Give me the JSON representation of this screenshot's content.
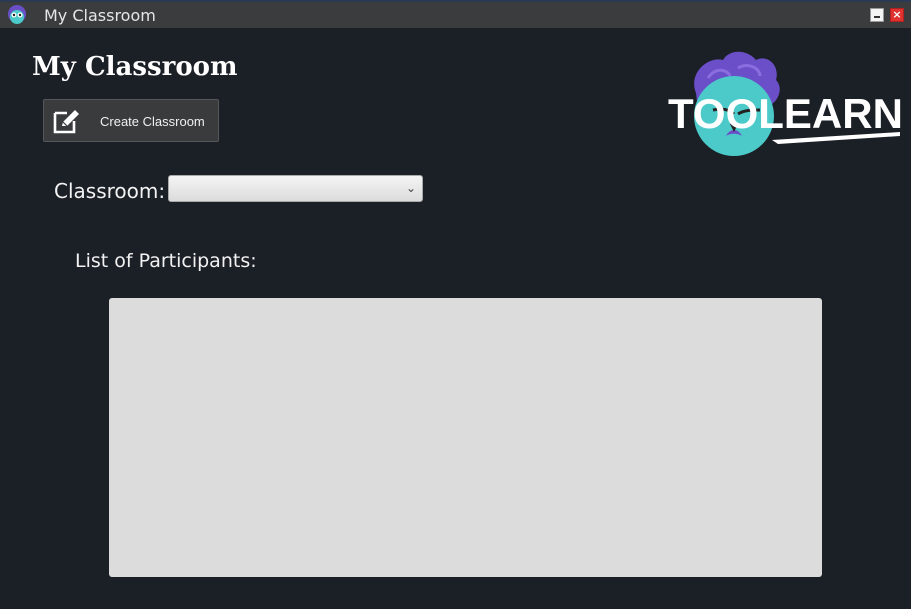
{
  "window": {
    "title": "My Classroom",
    "icons": {
      "app": "toolearn-mascot-icon",
      "minimize": "minimize-icon",
      "close": "close-icon"
    }
  },
  "page": {
    "title": "My Classroom",
    "create_button": {
      "label": "Create Classroom",
      "icon": "edit-icon"
    },
    "logo_text": "TOOLEARN",
    "classroom_label": "Classroom:",
    "classroom_select": {
      "selected": "",
      "icon": "chevron-down-icon"
    },
    "participants_label": "List of Participants:",
    "participants": []
  },
  "colors": {
    "background": "#1b1f26",
    "titlebar": "#3b3c3e",
    "button": "#3a3b3d",
    "list_bg": "#dcdcdc",
    "logo_hair": "#6a4fc8",
    "logo_face": "#4cc9c9"
  }
}
